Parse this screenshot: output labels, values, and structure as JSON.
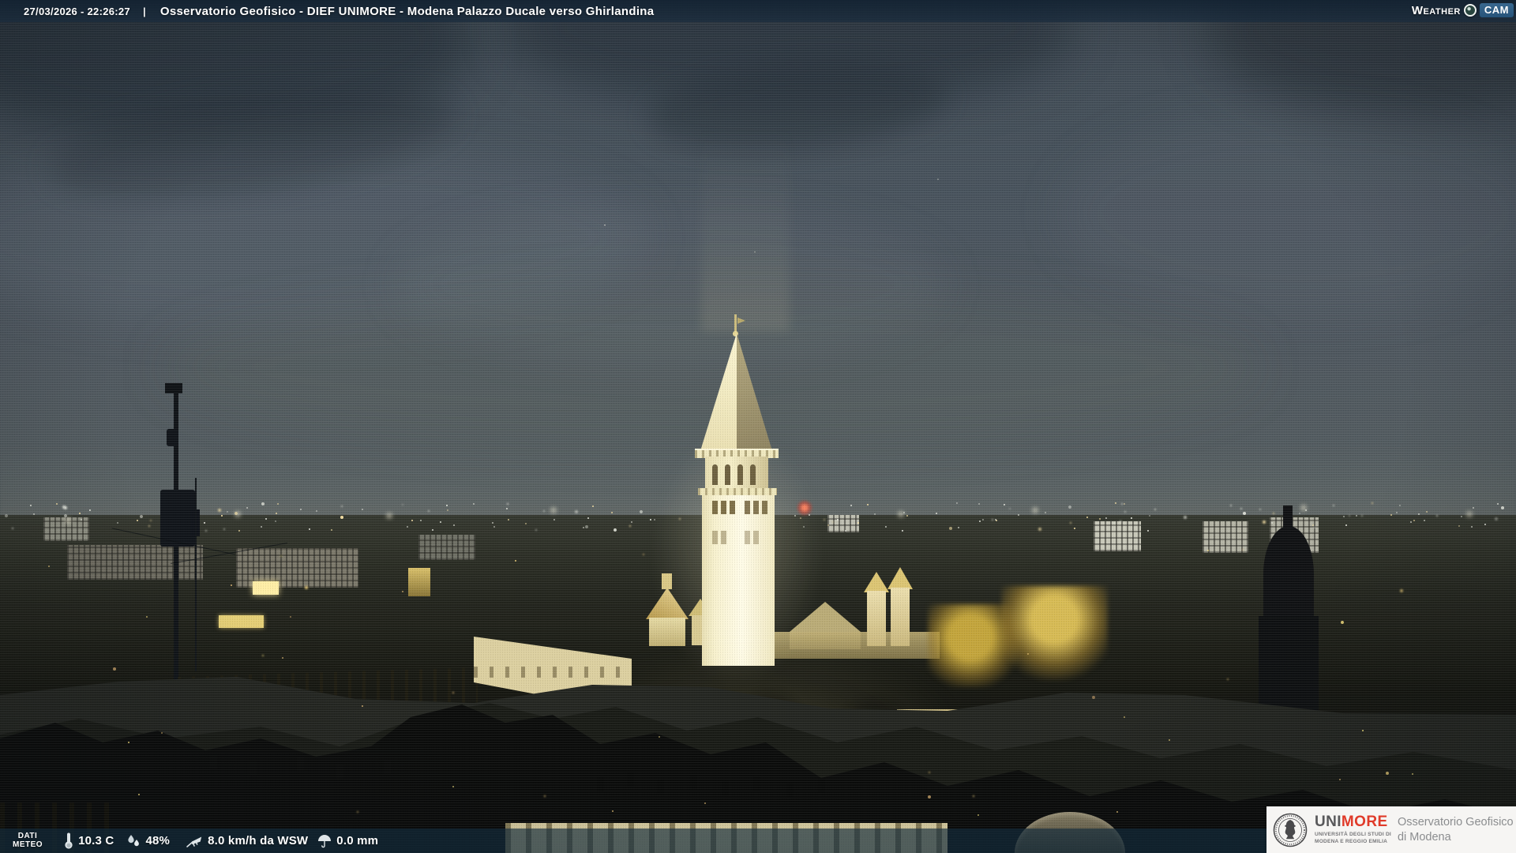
{
  "top_bar": {
    "datetime": "27/03/2026 - 22:26:27",
    "separator": "|",
    "title": "Osservatorio Geofisico - DIEF UNIMORE - Modena Palazzo Ducale verso Ghirlandina"
  },
  "weathercam_logo": {
    "weather_text": "Weather",
    "cam_text": "CAM",
    "lens_icon": "camera-lens-icon"
  },
  "bottom_bar": {
    "label_line1": "DATI",
    "label_line2": "METEO",
    "readings": [
      {
        "icon": "thermometer-icon",
        "value": "10.3 C"
      },
      {
        "icon": "humidity-drops-icon",
        "value": "48%"
      },
      {
        "icon": "wind-anemometer-icon",
        "value": "8.0 km/h da WSW"
      },
      {
        "icon": "rain-umbrella-icon",
        "value": "0.0 mm"
      }
    ]
  },
  "unimore_logo": {
    "seal_icon": "unimore-seal-icon",
    "uni": "UNI",
    "more": "MORE",
    "subtitle_line1": "UNIVERSITÀ DEGLI STUDI DI",
    "subtitle_line2": "MODENA E REGGIO EMILIA",
    "dept_line1": "Osservatorio Geofisico",
    "dept_line2": "di Modena"
  },
  "scene": {
    "description_labels": {
      "tower": "ghirlandina-tower",
      "city": "modena-night-skyline"
    }
  },
  "colors": {
    "top_bar_bg": "rgba(20,38,55,0.8)",
    "bottom_bar_bg": "rgba(19,44,61,0.66)",
    "cam_badge_blue": "#265379",
    "unimore_red": "#e03b2a",
    "unimore_gray": "#58585a",
    "tower_light": "#fdfae8",
    "facade_warm": "#efe3b0",
    "sky_base": "#4a545e",
    "beacon_red": "#d6402e"
  }
}
